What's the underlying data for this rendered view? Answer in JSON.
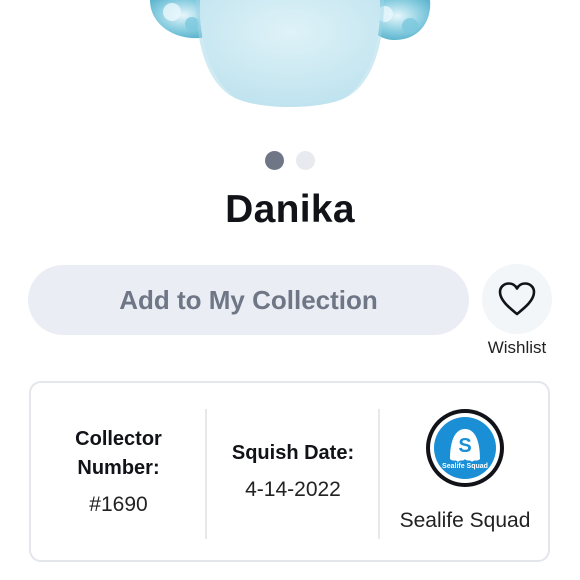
{
  "product": {
    "name": "Danika",
    "image_icon": "plush-image",
    "carousel": {
      "total": 2,
      "active_index": 0
    }
  },
  "actions": {
    "add_label": "Add to My Collection",
    "wishlist_label": "Wishlist",
    "wishlist_icon": "heart-icon"
  },
  "info": {
    "collector_label": "Collector\nNumber:",
    "collector_value": "#1690",
    "squish_label": "Squish Date:",
    "squish_value": "4-14-2022",
    "squad_name": "Sealife Squad",
    "badge_letter": "S",
    "badge_text": "Sealife Squad"
  },
  "colors": {
    "badge_blue": "#1a8fd6",
    "dot_active": "#6f7787",
    "dot_inactive": "#e8eaf0",
    "button_bg": "#eaedf3",
    "button_text": "#6f7787"
  }
}
